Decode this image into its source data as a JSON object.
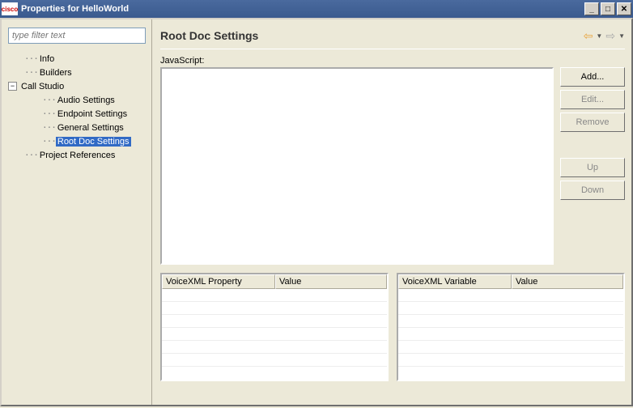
{
  "titlebar": {
    "logo": "cisco",
    "title": "Properties for HelloWorld"
  },
  "filter": {
    "placeholder": "type filter text"
  },
  "tree": {
    "info": "Info",
    "builders": "Builders",
    "callstudio": "Call Studio",
    "audio": "Audio Settings",
    "endpoint": "Endpoint Settings",
    "general": "General Settings",
    "rootdoc": "Root Doc Settings",
    "projectrefs": "Project References"
  },
  "header": {
    "title": "Root Doc Settings"
  },
  "labels": {
    "javascript": "JavaScript:"
  },
  "buttons": {
    "add": "Add...",
    "edit": "Edit...",
    "remove": "Remove",
    "up": "Up",
    "down": "Down"
  },
  "tables": {
    "property": {
      "col1": "VoiceXML Property",
      "col2": "Value"
    },
    "variable": {
      "col1": "VoiceXML Variable",
      "col2": "Value"
    }
  }
}
